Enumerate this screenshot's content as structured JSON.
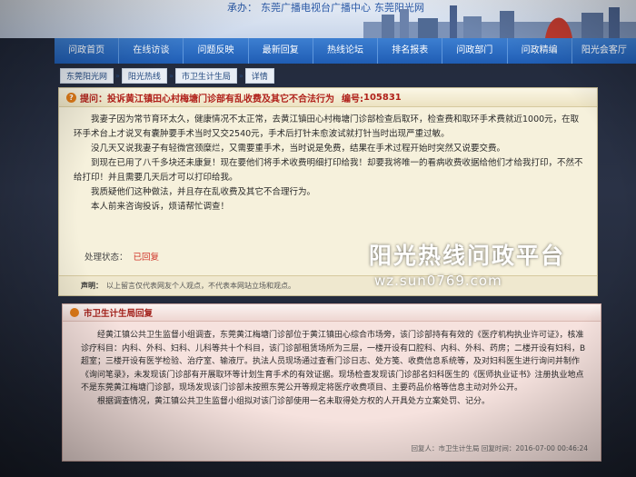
{
  "banner": {
    "tagline_prefix": "承办：",
    "tagline_org": "东莞广播电视台广播中心",
    "tagline_site": "东莞阳光网"
  },
  "nav": {
    "items": [
      {
        "label": "问政首页"
      },
      {
        "label": "在线访谈"
      },
      {
        "label": "问题反映"
      },
      {
        "label": "最新回复"
      },
      {
        "label": "热线论坛"
      },
      {
        "label": "排名报表"
      },
      {
        "label": "问政部门"
      },
      {
        "label": "问政精编"
      },
      {
        "label": "阳光会客厅"
      }
    ]
  },
  "breadcrumb": {
    "items": [
      "东莞阳光网",
      "阳光热线",
      "市卫生计生局",
      "详情"
    ],
    "separator": "»"
  },
  "question": {
    "prefix": "提问：",
    "title": "投诉黄江镇田心村梅塘门诊部有乱收费及其它不合法行为",
    "number_label": "编号:",
    "number": "105831",
    "paragraphs": [
      "我妻子因为常节育环太久，健康情况不太正常，去黄江镇田心村梅塘门诊部检查后取环，检查费和取环手术费就近1000元，在取环手术台上才说叉有囊肿要手术当时又交2540元，手术后打针未愈波试就打针当时出现严重过敏。",
      "没几天又说我妻子有轻微宫颈糜烂，又需要重手术，当时说是免费，结果在手术过程开始时突然又说要交费。",
      "到现在已用了八千多块还未康复！现在要他们将手术收费明细打印给我！却要我将唯一的看病收费收据给他们才给我打印，不然不给打印！并且需要几天后才可以打印给我。",
      "我质疑他们这种做法，并且存在乱收费及其它不合理行为。",
      "本人前来咨询投诉，烦请帮忙调查！"
    ],
    "status_label": "处理状态：",
    "status_value": "已回复",
    "disclaimer_label": "声明：",
    "disclaimer_text": "以上留言仅代表网友个人观点，不代表本网站立场和观点。"
  },
  "watermark": {
    "title": "阳光热线问政平台",
    "url": "wz.sun0769.com"
  },
  "reply": {
    "title": "市卫生计生局回复",
    "paragraphs": [
      "经黄江镇公共卫生监督小组调查，东莞黄江梅塘门诊部位于黄江镇田心综合市场旁，该门诊部持有有效的《医疗机构执业许可证》，核准诊疗科目：内科、外科、妇科、儿科等共十个科目，该门诊部租赁场所为三层，一楼开设有口腔科、内科、外科、药房；二楼开设有妇科，B超室；三楼开设有医学检验、治疗室、输液厅。执法人员现场通过查看门诊日志、处方笺、收费信息系统等，及对妇科医生进行询问并制作《询问笔录》，未发现该门诊部有开展取环等计划生育手术的有效证据。现场检查发现该门诊部名妇科医生的《医师执业证书》注册执业地点不是东莞黄江梅塘门诊部，现场发现该门诊部未按照东莞公开等规定将医疗收费项目、主要药品价格等信息主动对外公开。",
      "根据调查情况，黄江镇公共卫生监督小组拟对该门诊部使用一名未取得处方权的人开具处方立案处罚、记分。"
    ],
    "footer": "回复人：市卫生计生局 回复时间：2016-07-00 00:46:24"
  }
}
